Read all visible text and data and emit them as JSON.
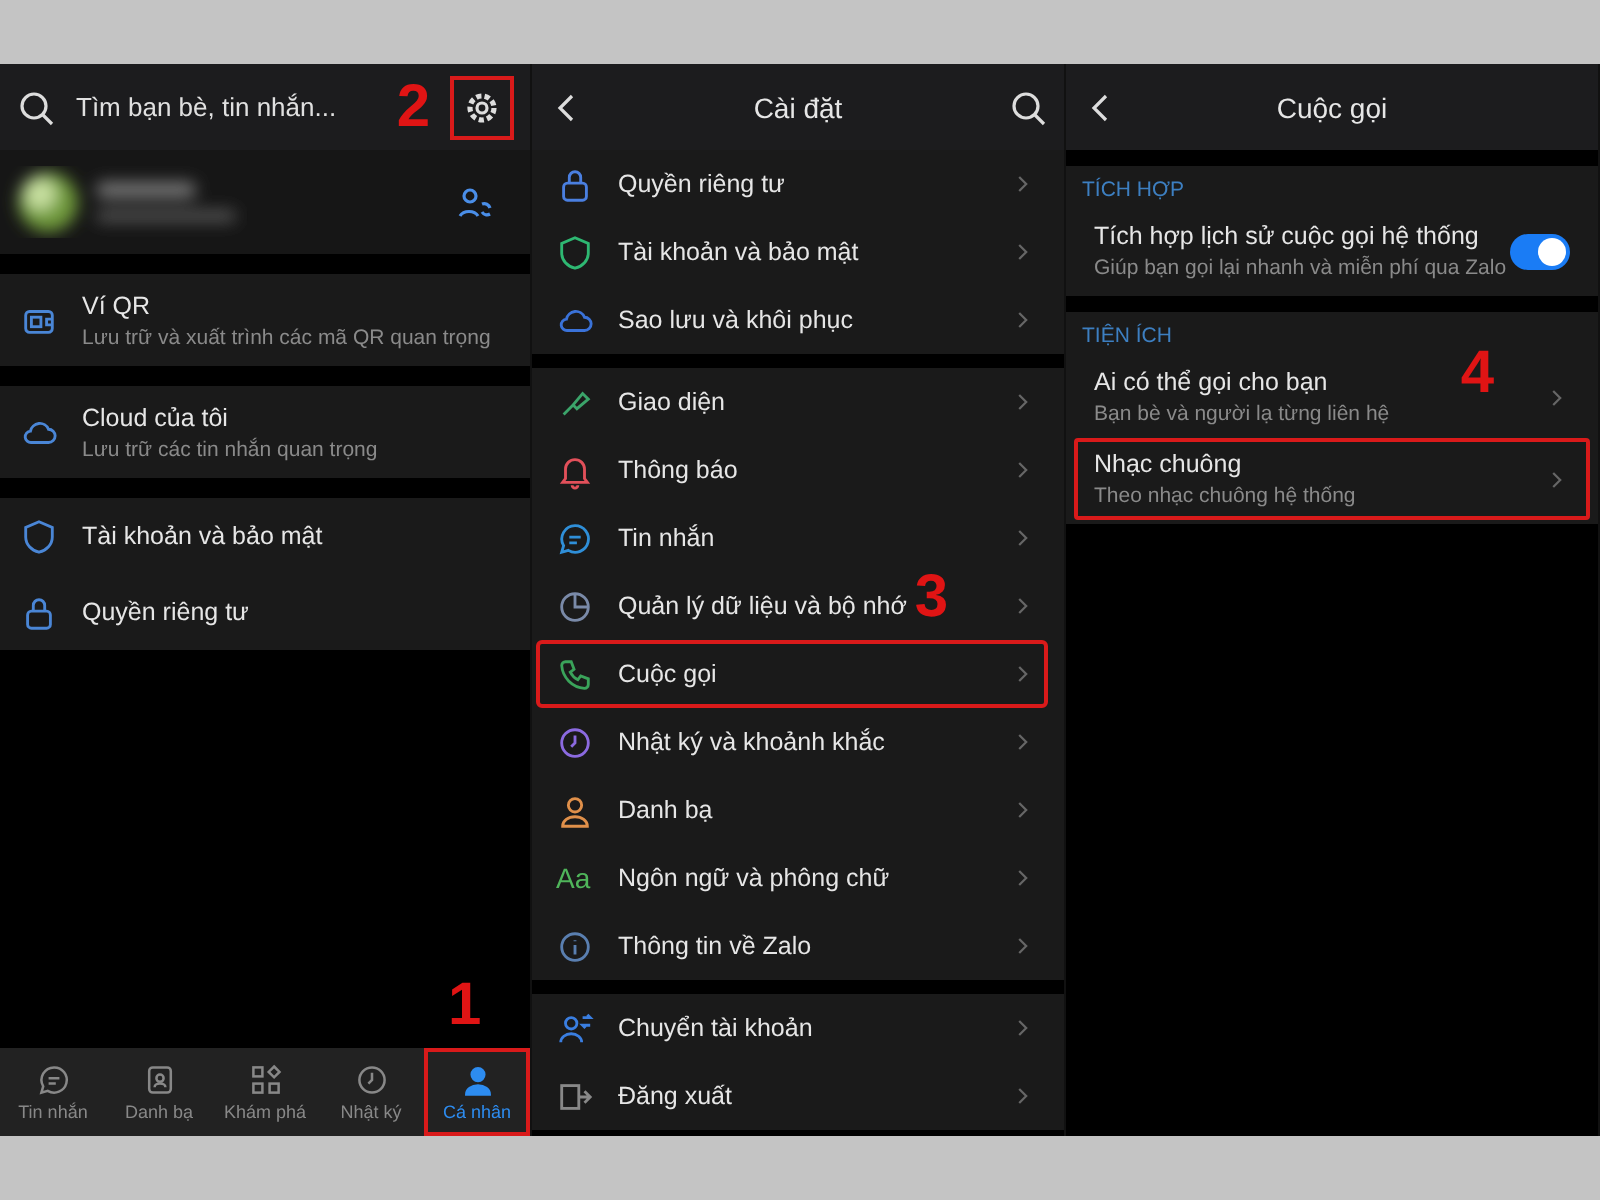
{
  "profile_screen": {
    "search_placeholder": "Tìm bạn bè, tin nhắn...",
    "settings_button": {
      "highlighted": true,
      "step": "2"
    },
    "groups": [
      [
        {
          "title": "Ví QR",
          "subtitle": "Lưu trữ và xuất trình các mã QR quan trọng"
        }
      ],
      [
        {
          "title": "Cloud của tôi",
          "subtitle": "Lưu trữ các tin nhắn quan trọng"
        }
      ],
      [
        {
          "title": "Tài khoản và bảo mật"
        },
        {
          "title": "Quyền riêng tư"
        }
      ]
    ],
    "nav": [
      {
        "label": "Tin nhắn",
        "selected": false,
        "highlighted": false
      },
      {
        "label": "Danh bạ",
        "selected": false,
        "highlighted": false
      },
      {
        "label": "Khám phá",
        "selected": false,
        "highlighted": false
      },
      {
        "label": "Nhật ký",
        "selected": false,
        "highlighted": false
      },
      {
        "label": "Cá nhân",
        "selected": true,
        "highlighted": true,
        "step": "1"
      }
    ]
  },
  "settings_screen": {
    "title": "Cài đặt",
    "groups": [
      [
        {
          "label": "Quyền riêng tư",
          "color": "#4a7fe0",
          "highlighted": false
        },
        {
          "label": "Tài khoản và bảo mật",
          "color": "#2eb872",
          "highlighted": false
        },
        {
          "label": "Sao lưu và khôi phục",
          "color": "#3a72d8",
          "highlighted": false
        }
      ],
      [
        {
          "label": "Giao diện",
          "color": "#3ba46a",
          "highlighted": false
        },
        {
          "label": "Thông báo",
          "color": "#e2505a",
          "highlighted": false
        },
        {
          "label": "Tin nhắn",
          "color": "#2f8fd8",
          "highlighted": false
        },
        {
          "label": "Quản lý dữ liệu và bộ nhớ",
          "color": "#7a8aa8",
          "highlighted": false
        },
        {
          "label": "Cuộc gọi",
          "color": "#3aa35a",
          "highlighted": true,
          "step": "3"
        },
        {
          "label": "Nhật ký và khoảnh khắc",
          "color": "#8b6ae0",
          "highlighted": false
        },
        {
          "label": "Danh bạ",
          "color": "#e0904a",
          "highlighted": false
        },
        {
          "label": "Ngôn ngữ và phông chữ",
          "color": "#4fb55a",
          "highlighted": false,
          "icon_text": "Aa"
        },
        {
          "label": "Thông tin về Zalo",
          "color": "#5a7fb0",
          "highlighted": false
        }
      ],
      [
        {
          "label": "Chuyển tài khoản",
          "color": "#3a7ee0",
          "highlighted": false
        },
        {
          "label": "Đăng xuất",
          "color": "#888888",
          "highlighted": false
        }
      ]
    ]
  },
  "calls_screen": {
    "title": "Cuộc gọi",
    "sections": [
      {
        "heading": "TÍCH HỢP",
        "rows": [
          {
            "kind": "toggle",
            "title": "Tích hợp lịch sử cuộc gọi hệ thống",
            "subtitle": "Giúp bạn gọi lại nhanh và miễn phí qua Zalo",
            "on": true,
            "highlighted": false
          }
        ]
      },
      {
        "heading": "TIỆN ÍCH",
        "rows": [
          {
            "kind": "link",
            "title": "Ai có thể gọi cho bạn",
            "subtitle": "Bạn bè và người lạ từng liên hệ",
            "highlighted": false
          },
          {
            "kind": "link",
            "title": "Nhạc chuông",
            "subtitle": "Theo nhạc chuông hệ thống",
            "highlighted": true,
            "step": "4"
          }
        ]
      }
    ]
  }
}
